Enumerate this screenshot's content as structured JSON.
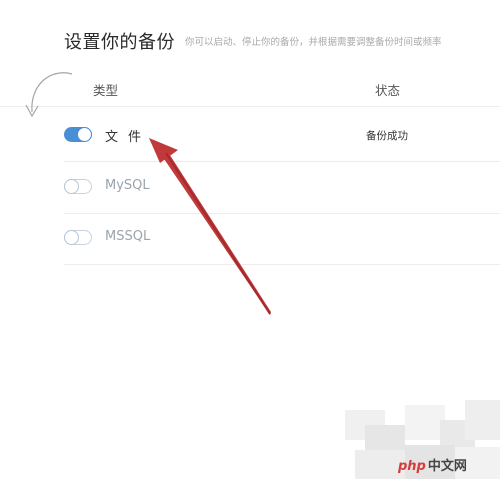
{
  "header": {
    "title": "设置你的备份",
    "subtitle": "你可以启动、停止你的备份，并根据需要调整备份时间或频率"
  },
  "table": {
    "columns": [
      "类型",
      "状态"
    ],
    "rows": [
      {
        "label": "文件",
        "enabled": true,
        "status": "备份成功"
      },
      {
        "label": "MySQL",
        "enabled": false,
        "status": ""
      },
      {
        "label": "MSSQL",
        "enabled": false,
        "status": ""
      }
    ]
  },
  "watermark": {
    "brand": "php",
    "suffix": "中文网"
  },
  "colors": {
    "toggle_on": "#4a8fd6",
    "arrow": "#c0393b",
    "watermark_php": "#d83b3b"
  },
  "icons": [
    "refresh-curve-arrow-icon",
    "annotation-arrow-icon"
  ]
}
